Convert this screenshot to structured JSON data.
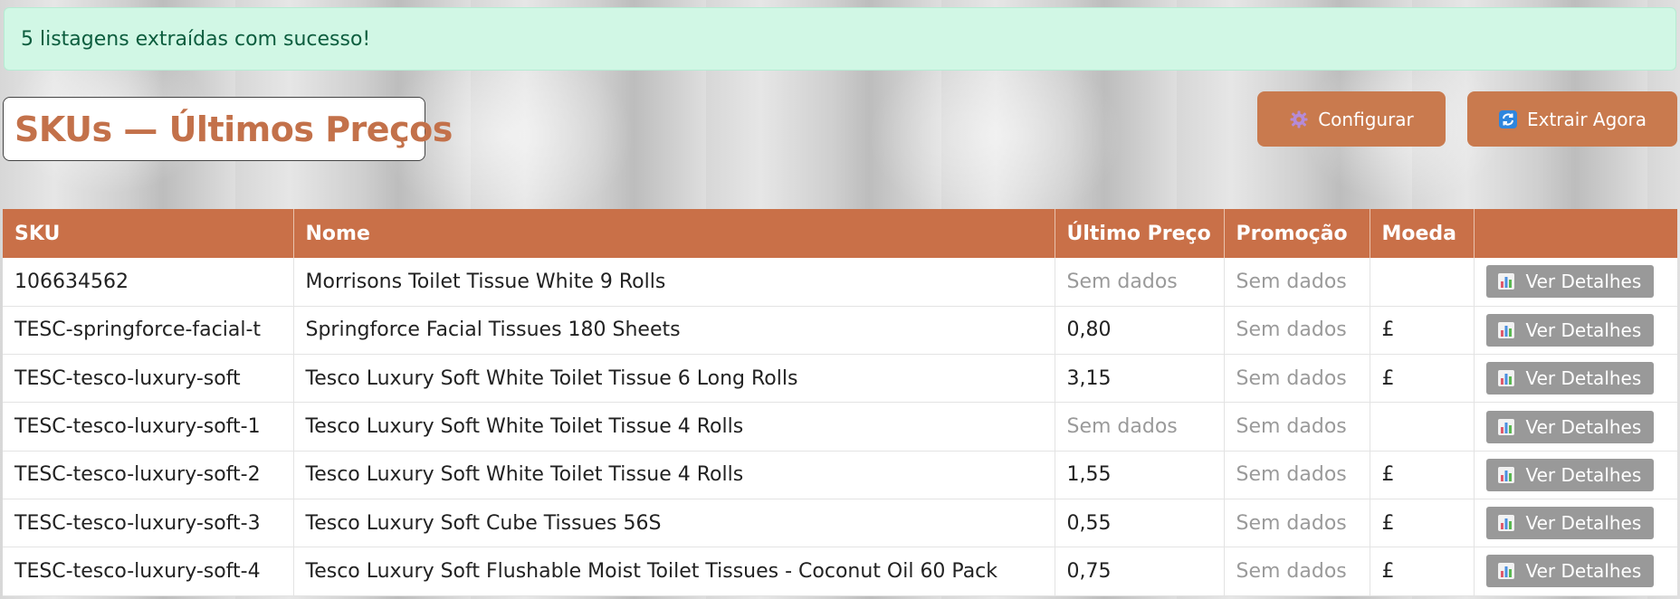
{
  "alert": {
    "message": "5 listagens extraídas com sucesso!"
  },
  "header": {
    "title": "SKUs — Últimos Preços",
    "config_label": "Configurar",
    "extract_label": "Extrair Agora",
    "config_icon": "gear-icon",
    "extract_icon": "refresh-icon"
  },
  "table": {
    "columns": [
      "SKU",
      "Nome",
      "Último Preço",
      "Promoção",
      "Moeda",
      ""
    ],
    "detail_label": "Ver Detalhes",
    "rows": [
      {
        "sku": "106634562",
        "name": "Morrisons Toilet Tissue White 9 Rolls",
        "price": "Sem dados",
        "promo": "Sem dados",
        "currency": ""
      },
      {
        "sku": "TESC-springforce-facial-t",
        "name": "Springforce Facial Tissues 180 Sheets",
        "price": "0,80",
        "promo": "Sem dados",
        "currency": "£"
      },
      {
        "sku": "TESC-tesco-luxury-soft",
        "name": "Tesco Luxury Soft White Toilet Tissue 6 Long Rolls",
        "price": "3,15",
        "promo": "Sem dados",
        "currency": "£"
      },
      {
        "sku": "TESC-tesco-luxury-soft-1",
        "name": "Tesco Luxury Soft White Toilet Tissue 4 Rolls",
        "price": "Sem dados",
        "promo": "Sem dados",
        "currency": ""
      },
      {
        "sku": "TESC-tesco-luxury-soft-2",
        "name": "Tesco Luxury Soft White Toilet Tissue 4 Rolls",
        "price": "1,55",
        "promo": "Sem dados",
        "currency": "£"
      },
      {
        "sku": "TESC-tesco-luxury-soft-3",
        "name": "Tesco Luxury Soft Cube Tissues 56S",
        "price": "0,55",
        "promo": "Sem dados",
        "currency": "£"
      },
      {
        "sku": "TESC-tesco-luxury-soft-4",
        "name": "Tesco Luxury Soft Flushable Moist Toilet Tissues - Coconut Oil 60 Pack",
        "price": "0,75",
        "promo": "Sem dados",
        "currency": "£"
      }
    ]
  },
  "colors": {
    "accent": "#c97048",
    "success_bg": "#d1f7e5",
    "success_text": "#0c5d3e",
    "muted": "#9a9a9a"
  }
}
